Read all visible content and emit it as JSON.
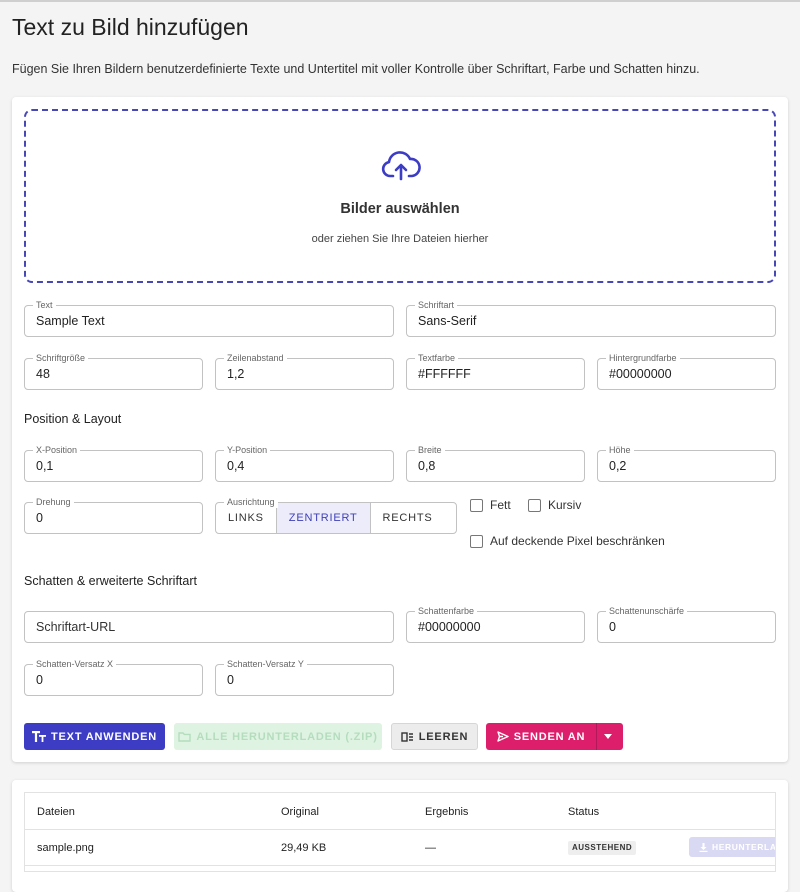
{
  "page": {
    "title": "Text zu Bild hinzufügen",
    "subtitle": "Fügen Sie Ihren Bildern benutzerdefinierte Texte und Untertitel mit voller Kontrolle über Schriftart, Farbe und Schatten hinzu."
  },
  "dropzone": {
    "icon": "cloud-upload-icon",
    "title": "Bilder auswählen",
    "subtitle": "oder ziehen Sie Ihre Dateien hierher"
  },
  "fields": {
    "text": {
      "label": "Text",
      "value": "Sample Text"
    },
    "font": {
      "label": "Schriftart",
      "value": "Sans-Serif"
    },
    "font_size": {
      "label": "Schriftgröße",
      "value": "48"
    },
    "line_height": {
      "label": "Zeilenabstand",
      "value": "1,2"
    },
    "text_color": {
      "label": "Textfarbe",
      "value": "#FFFFFF"
    },
    "bg_color": {
      "label": "Hintergrundfarbe",
      "value": "#00000000"
    }
  },
  "position_layout": {
    "heading": "Position & Layout",
    "x": {
      "label": "X-Position",
      "value": "0,1"
    },
    "y": {
      "label": "Y-Position",
      "value": "0,4"
    },
    "width": {
      "label": "Breite",
      "value": "0,8"
    },
    "height": {
      "label": "Höhe",
      "value": "0,2"
    },
    "rotation": {
      "label": "Drehung",
      "value": "0"
    },
    "alignment": {
      "label": "Ausrichtung",
      "options": [
        "LINKS",
        "ZENTRIERT",
        "RECHTS"
      ],
      "selected": "ZENTRIERT"
    },
    "bold_label": "Fett",
    "italic_label": "Kursiv",
    "opaque_label": "Auf deckende Pixel beschränken"
  },
  "shadow": {
    "heading": "Schatten & erweiterte Schriftart",
    "font_url": {
      "placeholder": "Schriftart-URL"
    },
    "color": {
      "label": "Schattenfarbe",
      "value": "#00000000"
    },
    "blur": {
      "label": "Schattenunschärfe",
      "value": "0"
    },
    "offset_x": {
      "label": "Schatten-Versatz X",
      "value": "0"
    },
    "offset_y": {
      "label": "Schatten-Versatz Y",
      "value": "0"
    }
  },
  "actions": {
    "apply": "TEXT ANWENDEN",
    "download_all": "ALLE HERUNTERLADEN (.ZIP)",
    "clear": "LEEREN",
    "send": "SENDEN AN"
  },
  "colors": {
    "primary": "#3c3cc4",
    "send": "#dc1e6b",
    "zip_disabled": "#dff3e3"
  },
  "table": {
    "headers": [
      "Dateien",
      "Original",
      "Ergebnis",
      "Status"
    ],
    "rows": [
      {
        "file": "sample.png",
        "original": "29,49 KB",
        "result": "—",
        "status": "AUSSTEHEND",
        "download": "HERUNTERLADEN"
      }
    ]
  }
}
